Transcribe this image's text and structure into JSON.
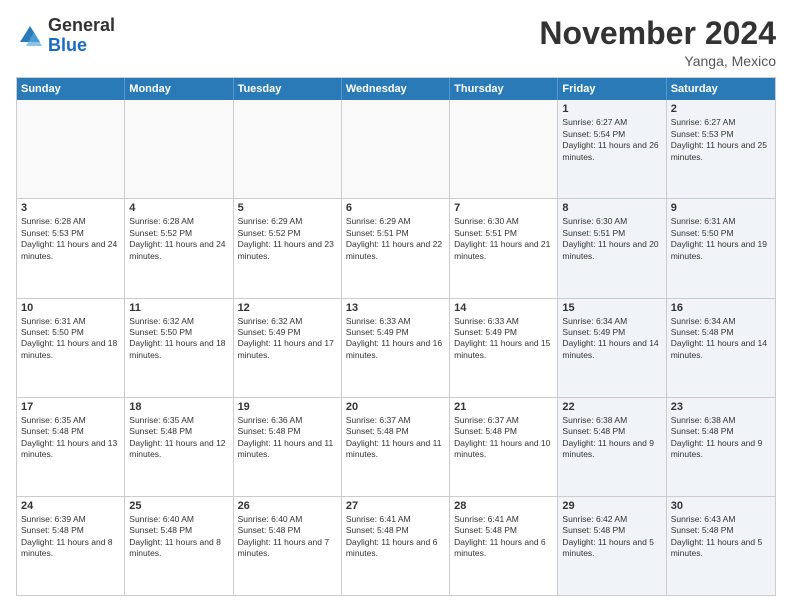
{
  "logo": {
    "general": "General",
    "blue": "Blue"
  },
  "header": {
    "month": "November 2024",
    "location": "Yanga, Mexico"
  },
  "days": [
    "Sunday",
    "Monday",
    "Tuesday",
    "Wednesday",
    "Thursday",
    "Friday",
    "Saturday"
  ],
  "weeks": [
    [
      {
        "day": "",
        "text": "",
        "empty": true
      },
      {
        "day": "",
        "text": "",
        "empty": true
      },
      {
        "day": "",
        "text": "",
        "empty": true
      },
      {
        "day": "",
        "text": "",
        "empty": true
      },
      {
        "day": "",
        "text": "",
        "empty": true
      },
      {
        "day": "1",
        "text": "Sunrise: 6:27 AM\nSunset: 5:54 PM\nDaylight: 11 hours and 26 minutes.",
        "empty": false,
        "shaded": true
      },
      {
        "day": "2",
        "text": "Sunrise: 6:27 AM\nSunset: 5:53 PM\nDaylight: 11 hours and 25 minutes.",
        "empty": false,
        "shaded": true
      }
    ],
    [
      {
        "day": "3",
        "text": "Sunrise: 6:28 AM\nSunset: 5:53 PM\nDaylight: 11 hours and 24 minutes.",
        "empty": false
      },
      {
        "day": "4",
        "text": "Sunrise: 6:28 AM\nSunset: 5:52 PM\nDaylight: 11 hours and 24 minutes.",
        "empty": false
      },
      {
        "day": "5",
        "text": "Sunrise: 6:29 AM\nSunset: 5:52 PM\nDaylight: 11 hours and 23 minutes.",
        "empty": false
      },
      {
        "day": "6",
        "text": "Sunrise: 6:29 AM\nSunset: 5:51 PM\nDaylight: 11 hours and 22 minutes.",
        "empty": false
      },
      {
        "day": "7",
        "text": "Sunrise: 6:30 AM\nSunset: 5:51 PM\nDaylight: 11 hours and 21 minutes.",
        "empty": false
      },
      {
        "day": "8",
        "text": "Sunrise: 6:30 AM\nSunset: 5:51 PM\nDaylight: 11 hours and 20 minutes.",
        "empty": false,
        "shaded": true
      },
      {
        "day": "9",
        "text": "Sunrise: 6:31 AM\nSunset: 5:50 PM\nDaylight: 11 hours and 19 minutes.",
        "empty": false,
        "shaded": true
      }
    ],
    [
      {
        "day": "10",
        "text": "Sunrise: 6:31 AM\nSunset: 5:50 PM\nDaylight: 11 hours and 18 minutes.",
        "empty": false
      },
      {
        "day": "11",
        "text": "Sunrise: 6:32 AM\nSunset: 5:50 PM\nDaylight: 11 hours and 18 minutes.",
        "empty": false
      },
      {
        "day": "12",
        "text": "Sunrise: 6:32 AM\nSunset: 5:49 PM\nDaylight: 11 hours and 17 minutes.",
        "empty": false
      },
      {
        "day": "13",
        "text": "Sunrise: 6:33 AM\nSunset: 5:49 PM\nDaylight: 11 hours and 16 minutes.",
        "empty": false
      },
      {
        "day": "14",
        "text": "Sunrise: 6:33 AM\nSunset: 5:49 PM\nDaylight: 11 hours and 15 minutes.",
        "empty": false
      },
      {
        "day": "15",
        "text": "Sunrise: 6:34 AM\nSunset: 5:49 PM\nDaylight: 11 hours and 14 minutes.",
        "empty": false,
        "shaded": true
      },
      {
        "day": "16",
        "text": "Sunrise: 6:34 AM\nSunset: 5:48 PM\nDaylight: 11 hours and 14 minutes.",
        "empty": false,
        "shaded": true
      }
    ],
    [
      {
        "day": "17",
        "text": "Sunrise: 6:35 AM\nSunset: 5:48 PM\nDaylight: 11 hours and 13 minutes.",
        "empty": false
      },
      {
        "day": "18",
        "text": "Sunrise: 6:35 AM\nSunset: 5:48 PM\nDaylight: 11 hours and 12 minutes.",
        "empty": false
      },
      {
        "day": "19",
        "text": "Sunrise: 6:36 AM\nSunset: 5:48 PM\nDaylight: 11 hours and 11 minutes.",
        "empty": false
      },
      {
        "day": "20",
        "text": "Sunrise: 6:37 AM\nSunset: 5:48 PM\nDaylight: 11 hours and 11 minutes.",
        "empty": false
      },
      {
        "day": "21",
        "text": "Sunrise: 6:37 AM\nSunset: 5:48 PM\nDaylight: 11 hours and 10 minutes.",
        "empty": false
      },
      {
        "day": "22",
        "text": "Sunrise: 6:38 AM\nSunset: 5:48 PM\nDaylight: 11 hours and 9 minutes.",
        "empty": false,
        "shaded": true
      },
      {
        "day": "23",
        "text": "Sunrise: 6:38 AM\nSunset: 5:48 PM\nDaylight: 11 hours and 9 minutes.",
        "empty": false,
        "shaded": true
      }
    ],
    [
      {
        "day": "24",
        "text": "Sunrise: 6:39 AM\nSunset: 5:48 PM\nDaylight: 11 hours and 8 minutes.",
        "empty": false
      },
      {
        "day": "25",
        "text": "Sunrise: 6:40 AM\nSunset: 5:48 PM\nDaylight: 11 hours and 8 minutes.",
        "empty": false
      },
      {
        "day": "26",
        "text": "Sunrise: 6:40 AM\nSunset: 5:48 PM\nDaylight: 11 hours and 7 minutes.",
        "empty": false
      },
      {
        "day": "27",
        "text": "Sunrise: 6:41 AM\nSunset: 5:48 PM\nDaylight: 11 hours and 6 minutes.",
        "empty": false
      },
      {
        "day": "28",
        "text": "Sunrise: 6:41 AM\nSunset: 5:48 PM\nDaylight: 11 hours and 6 minutes.",
        "empty": false
      },
      {
        "day": "29",
        "text": "Sunrise: 6:42 AM\nSunset: 5:48 PM\nDaylight: 11 hours and 5 minutes.",
        "empty": false,
        "shaded": true
      },
      {
        "day": "30",
        "text": "Sunrise: 6:43 AM\nSunset: 5:48 PM\nDaylight: 11 hours and 5 minutes.",
        "empty": false,
        "shaded": true
      }
    ]
  ]
}
